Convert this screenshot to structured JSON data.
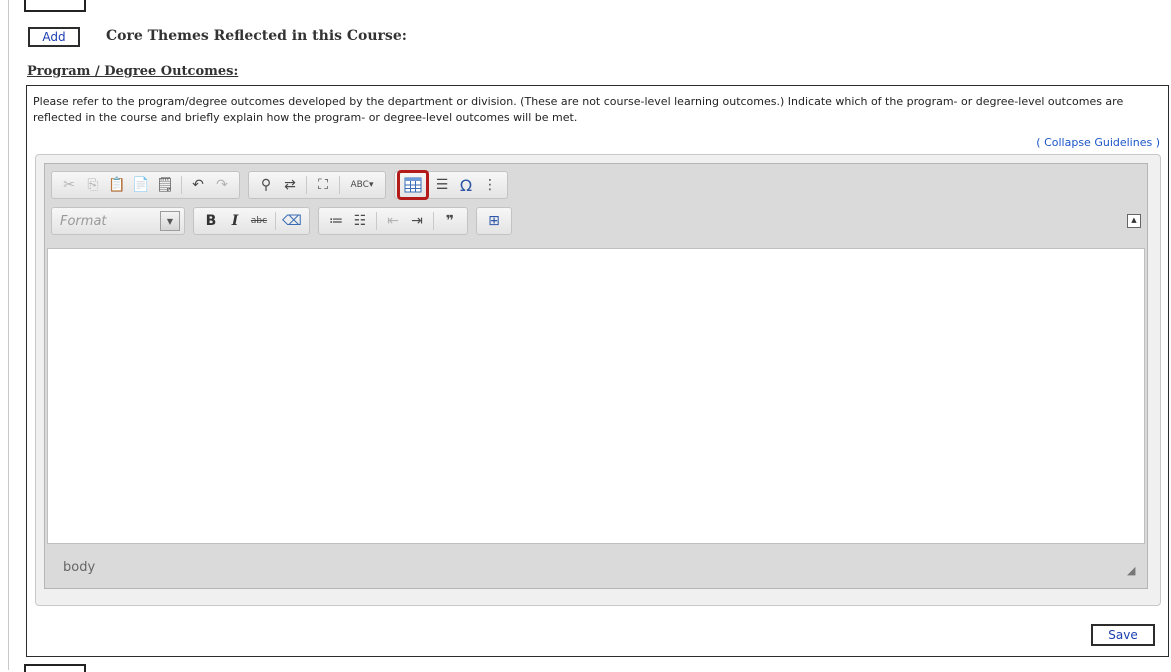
{
  "header": {
    "add_label": "Add",
    "core_themes_label": "Core Themes Reflected in this Course:"
  },
  "section": {
    "title": "Program / Degree Outcomes:",
    "guidelines": "Please refer to the program/degree outcomes developed by the department or division. (These are not course-level learning outcomes.) Indicate which of the program- or degree-level outcomes are reflected in the course and briefly explain how the program- or degree-level outcomes will be met.",
    "collapse_link": "( Collapse Guidelines )"
  },
  "editor": {
    "format_placeholder": "Format",
    "toolbar_text": {
      "bold": "B",
      "italic": "I",
      "strike": "abc",
      "omega": "Ω",
      "spell": "ABC",
      "quote": "❞"
    },
    "status_path": "body"
  },
  "footer": {
    "save_label": "Save"
  },
  "icons": {
    "highlight_color": "#b31b1b"
  }
}
